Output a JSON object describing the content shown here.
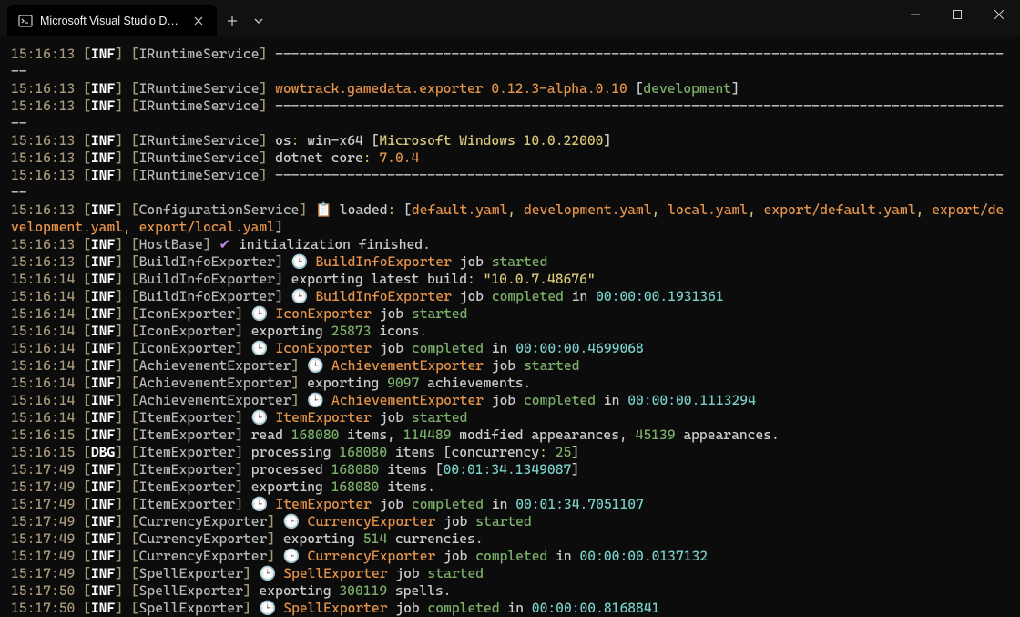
{
  "titlebar": {
    "tab_title": "Microsoft Visual Studio Debug"
  },
  "colors": {
    "timestamp": "#a99a7c",
    "bracket": "#a99a7c",
    "level": "#ffffff",
    "service": "#b8b8b8",
    "orange": "#e5934a",
    "green": "#7bb06a",
    "yellow": "#d8c87a",
    "lightblue": "#7ad0c8",
    "purple": "#c188e0",
    "gray": "#cccccc"
  },
  "icons": {
    "clock": "🕒",
    "clipboard": "📋",
    "check": "✔"
  },
  "log": [
    {
      "ts": "15:16:13",
      "lvl": "INF",
      "svc": "IRuntimeService",
      "segs": [
        {
          "t": "---------------------------------------------------------------------------------------------",
          "c": "gray"
        }
      ]
    },
    {
      "ts": "15:16:13",
      "lvl": "INF",
      "svc": "IRuntimeService",
      "segs": [
        {
          "t": "wowtrack.gamedata.exporter 0.12.3-alpha.0.10",
          "c": "orange"
        },
        {
          "t": " [",
          "c": "gray"
        },
        {
          "t": "development",
          "c": "green"
        },
        {
          "t": "]",
          "c": "gray"
        }
      ]
    },
    {
      "ts": "15:16:13",
      "lvl": "INF",
      "svc": "IRuntimeService",
      "segs": [
        {
          "t": "---------------------------------------------------------------------------------------------",
          "c": "gray"
        }
      ]
    },
    {
      "ts": "15:16:13",
      "lvl": "INF",
      "svc": "IRuntimeService",
      "segs": [
        {
          "t": "os",
          "c": "gray"
        },
        {
          "t": ":",
          "c": "yellow"
        },
        {
          "t": " win-x64 ",
          "c": "gray"
        },
        {
          "t": "[",
          "c": "gray"
        },
        {
          "t": "Microsoft Windows 10.0.22000",
          "c": "yellow"
        },
        {
          "t": "]",
          "c": "gray"
        }
      ]
    },
    {
      "ts": "15:16:13",
      "lvl": "INF",
      "svc": "IRuntimeService",
      "segs": [
        {
          "t": "dotnet core",
          "c": "gray"
        },
        {
          "t": ":",
          "c": "yellow"
        },
        {
          "t": " ",
          "c": "gray"
        },
        {
          "t": "7.0.4",
          "c": "orange"
        }
      ]
    },
    {
      "ts": "15:16:13",
      "lvl": "INF",
      "svc": "IRuntimeService",
      "segs": [
        {
          "t": "---------------------------------------------------------------------------------------------",
          "c": "gray"
        }
      ]
    },
    {
      "ts": "15:16:13",
      "lvl": "INF",
      "svc": "ConfigurationService",
      "segs": [
        {
          "t": "📋",
          "c": "emoji"
        },
        {
          "t": " loaded",
          "c": "gray"
        },
        {
          "t": ":",
          "c": "yellow"
        },
        {
          "t": " [",
          "c": "gray"
        },
        {
          "t": "default.yaml",
          "c": "orange"
        },
        {
          "t": ", ",
          "c": "yellow"
        },
        {
          "t": "development.yaml",
          "c": "orange"
        },
        {
          "t": ", ",
          "c": "yellow"
        },
        {
          "t": "local.yaml",
          "c": "orange"
        },
        {
          "t": ", ",
          "c": "yellow"
        },
        {
          "t": "export/default.yaml",
          "c": "orange"
        },
        {
          "t": ", ",
          "c": "yellow"
        },
        {
          "t": "export/development.yaml",
          "c": "orange"
        },
        {
          "t": ", ",
          "c": "yellow"
        },
        {
          "t": "export/local.yaml",
          "c": "orange"
        },
        {
          "t": "]",
          "c": "gray"
        }
      ]
    },
    {
      "ts": "15:16:13",
      "lvl": "INF",
      "svc": "HostBase",
      "segs": [
        {
          "t": "✔",
          "c": "purple"
        },
        {
          "t": " initialization finished.",
          "c": "gray"
        }
      ]
    },
    {
      "ts": "15:16:13",
      "lvl": "INF",
      "svc": "BuildInfoExporter",
      "segs": [
        {
          "t": "🕒",
          "c": "emoji"
        },
        {
          "t": " ",
          "c": "gray"
        },
        {
          "t": "BuildInfoExporter",
          "c": "orange"
        },
        {
          "t": " job ",
          "c": "gray"
        },
        {
          "t": "started",
          "c": "green"
        }
      ]
    },
    {
      "ts": "15:16:14",
      "lvl": "INF",
      "svc": "BuildInfoExporter",
      "segs": [
        {
          "t": "exporting latest build: ",
          "c": "gray"
        },
        {
          "t": "\"10.0.7.48676\"",
          "c": "yellow"
        }
      ]
    },
    {
      "ts": "15:16:14",
      "lvl": "INF",
      "svc": "BuildInfoExporter",
      "segs": [
        {
          "t": "🕒",
          "c": "emoji"
        },
        {
          "t": " ",
          "c": "gray"
        },
        {
          "t": "BuildInfoExporter",
          "c": "orange"
        },
        {
          "t": " job ",
          "c": "gray"
        },
        {
          "t": "completed",
          "c": "green"
        },
        {
          "t": " in ",
          "c": "gray"
        },
        {
          "t": "00:00:00.1931361",
          "c": "lightblue"
        }
      ]
    },
    {
      "ts": "15:16:14",
      "lvl": "INF",
      "svc": "IconExporter",
      "segs": [
        {
          "t": "🕒",
          "c": "emoji"
        },
        {
          "t": " ",
          "c": "gray"
        },
        {
          "t": "IconExporter",
          "c": "orange"
        },
        {
          "t": " job ",
          "c": "gray"
        },
        {
          "t": "started",
          "c": "green"
        }
      ]
    },
    {
      "ts": "15:16:14",
      "lvl": "INF",
      "svc": "IconExporter",
      "segs": [
        {
          "t": "exporting ",
          "c": "gray"
        },
        {
          "t": "25873",
          "c": "green"
        },
        {
          "t": " icons.",
          "c": "gray"
        }
      ]
    },
    {
      "ts": "15:16:14",
      "lvl": "INF",
      "svc": "IconExporter",
      "segs": [
        {
          "t": "🕒",
          "c": "emoji"
        },
        {
          "t": " ",
          "c": "gray"
        },
        {
          "t": "IconExporter",
          "c": "orange"
        },
        {
          "t": " job ",
          "c": "gray"
        },
        {
          "t": "completed",
          "c": "green"
        },
        {
          "t": " in ",
          "c": "gray"
        },
        {
          "t": "00:00:00.4699068",
          "c": "lightblue"
        }
      ]
    },
    {
      "ts": "15:16:14",
      "lvl": "INF",
      "svc": "AchievementExporter",
      "segs": [
        {
          "t": "🕒",
          "c": "emoji"
        },
        {
          "t": " ",
          "c": "gray"
        },
        {
          "t": "AchievementExporter",
          "c": "orange"
        },
        {
          "t": " job ",
          "c": "gray"
        },
        {
          "t": "started",
          "c": "green"
        }
      ]
    },
    {
      "ts": "15:16:14",
      "lvl": "INF",
      "svc": "AchievementExporter",
      "segs": [
        {
          "t": "exporting ",
          "c": "gray"
        },
        {
          "t": "9097",
          "c": "green"
        },
        {
          "t": " achievements.",
          "c": "gray"
        }
      ]
    },
    {
      "ts": "15:16:14",
      "lvl": "INF",
      "svc": "AchievementExporter",
      "segs": [
        {
          "t": "🕒",
          "c": "emoji"
        },
        {
          "t": " ",
          "c": "gray"
        },
        {
          "t": "AchievementExporter",
          "c": "orange"
        },
        {
          "t": " job ",
          "c": "gray"
        },
        {
          "t": "completed",
          "c": "green"
        },
        {
          "t": " in ",
          "c": "gray"
        },
        {
          "t": "00:00:00.1113294",
          "c": "lightblue"
        }
      ]
    },
    {
      "ts": "15:16:14",
      "lvl": "INF",
      "svc": "ItemExporter",
      "segs": [
        {
          "t": "🕒",
          "c": "emoji"
        },
        {
          "t": " ",
          "c": "gray"
        },
        {
          "t": "ItemExporter",
          "c": "orange"
        },
        {
          "t": " job ",
          "c": "gray"
        },
        {
          "t": "started",
          "c": "green"
        }
      ]
    },
    {
      "ts": "15:16:15",
      "lvl": "INF",
      "svc": "ItemExporter",
      "segs": [
        {
          "t": "read ",
          "c": "gray"
        },
        {
          "t": "168080",
          "c": "green"
        },
        {
          "t": " items, ",
          "c": "gray"
        },
        {
          "t": "114489",
          "c": "green"
        },
        {
          "t": " modified appearances, ",
          "c": "gray"
        },
        {
          "t": "45139",
          "c": "green"
        },
        {
          "t": " appearances.",
          "c": "gray"
        }
      ]
    },
    {
      "ts": "15:16:15",
      "lvl": "DBG",
      "svc": "ItemExporter",
      "segs": [
        {
          "t": "processing ",
          "c": "gray"
        },
        {
          "t": "168080",
          "c": "green"
        },
        {
          "t": " items [",
          "c": "gray"
        },
        {
          "t": "concurrency",
          "c": "gray"
        },
        {
          "t": ":",
          "c": "yellow"
        },
        {
          "t": " ",
          "c": "gray"
        },
        {
          "t": "25",
          "c": "green"
        },
        {
          "t": "]",
          "c": "gray"
        }
      ]
    },
    {
      "ts": "15:17:49",
      "lvl": "INF",
      "svc": "ItemExporter",
      "segs": [
        {
          "t": "processed ",
          "c": "gray"
        },
        {
          "t": "168080",
          "c": "green"
        },
        {
          "t": " items [",
          "c": "gray"
        },
        {
          "t": "00:01:34.1349087",
          "c": "lightblue"
        },
        {
          "t": "]",
          "c": "gray"
        }
      ]
    },
    {
      "ts": "15:17:49",
      "lvl": "INF",
      "svc": "ItemExporter",
      "segs": [
        {
          "t": "exporting ",
          "c": "gray"
        },
        {
          "t": "168080",
          "c": "green"
        },
        {
          "t": " items.",
          "c": "gray"
        }
      ]
    },
    {
      "ts": "15:17:49",
      "lvl": "INF",
      "svc": "ItemExporter",
      "segs": [
        {
          "t": "🕒",
          "c": "emoji"
        },
        {
          "t": " ",
          "c": "gray"
        },
        {
          "t": "ItemExporter",
          "c": "orange"
        },
        {
          "t": " job ",
          "c": "gray"
        },
        {
          "t": "completed",
          "c": "green"
        },
        {
          "t": " in ",
          "c": "gray"
        },
        {
          "t": "00:01:34.7051107",
          "c": "lightblue"
        }
      ]
    },
    {
      "ts": "15:17:49",
      "lvl": "INF",
      "svc": "CurrencyExporter",
      "segs": [
        {
          "t": "🕒",
          "c": "emoji"
        },
        {
          "t": " ",
          "c": "gray"
        },
        {
          "t": "CurrencyExporter",
          "c": "orange"
        },
        {
          "t": " job ",
          "c": "gray"
        },
        {
          "t": "started",
          "c": "green"
        }
      ]
    },
    {
      "ts": "15:17:49",
      "lvl": "INF",
      "svc": "CurrencyExporter",
      "segs": [
        {
          "t": "exporting ",
          "c": "gray"
        },
        {
          "t": "514",
          "c": "green"
        },
        {
          "t": " currencies.",
          "c": "gray"
        }
      ]
    },
    {
      "ts": "15:17:49",
      "lvl": "INF",
      "svc": "CurrencyExporter",
      "segs": [
        {
          "t": "🕒",
          "c": "emoji"
        },
        {
          "t": " ",
          "c": "gray"
        },
        {
          "t": "CurrencyExporter",
          "c": "orange"
        },
        {
          "t": " job ",
          "c": "gray"
        },
        {
          "t": "completed",
          "c": "green"
        },
        {
          "t": " in ",
          "c": "gray"
        },
        {
          "t": "00:00:00.0137132",
          "c": "lightblue"
        }
      ]
    },
    {
      "ts": "15:17:49",
      "lvl": "INF",
      "svc": "SpellExporter",
      "segs": [
        {
          "t": "🕒",
          "c": "emoji"
        },
        {
          "t": " ",
          "c": "gray"
        },
        {
          "t": "SpellExporter",
          "c": "orange"
        },
        {
          "t": " job ",
          "c": "gray"
        },
        {
          "t": "started",
          "c": "green"
        }
      ]
    },
    {
      "ts": "15:17:50",
      "lvl": "INF",
      "svc": "SpellExporter",
      "segs": [
        {
          "t": "exporting ",
          "c": "gray"
        },
        {
          "t": "300119",
          "c": "green"
        },
        {
          "t": " spells.",
          "c": "gray"
        }
      ]
    },
    {
      "ts": "15:17:50",
      "lvl": "INF",
      "svc": "SpellExporter",
      "segs": [
        {
          "t": "🕒",
          "c": "emoji"
        },
        {
          "t": " ",
          "c": "gray"
        },
        {
          "t": "SpellExporter",
          "c": "orange"
        },
        {
          "t": " job ",
          "c": "gray"
        },
        {
          "t": "completed",
          "c": "green"
        },
        {
          "t": " in ",
          "c": "gray"
        },
        {
          "t": "00:00:00.8168841",
          "c": "lightblue"
        }
      ]
    }
  ]
}
